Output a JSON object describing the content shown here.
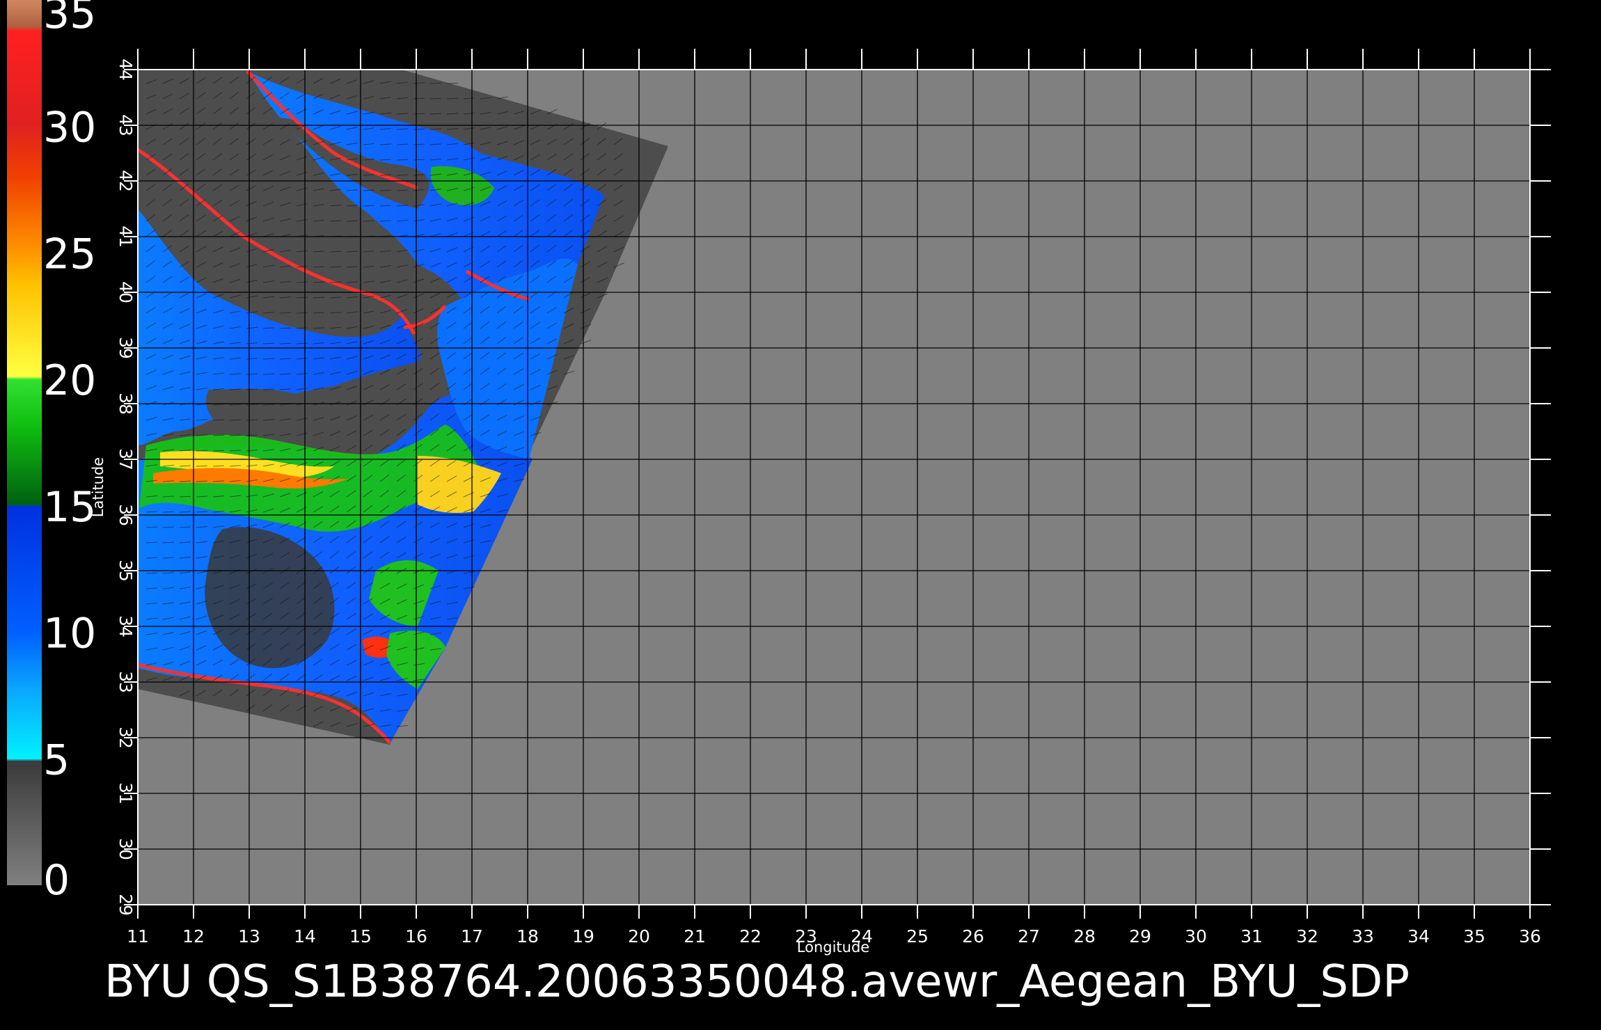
{
  "map": {
    "xlabel": "Longitude",
    "ylabel": "Latitude",
    "lon_range": [
      11,
      36
    ],
    "lat_range": [
      29,
      44
    ],
    "lon_ticks": [
      "11",
      "12",
      "13",
      "14",
      "15",
      "16",
      "17",
      "18",
      "19",
      "20",
      "21",
      "22",
      "23",
      "24",
      "25",
      "26",
      "27",
      "28",
      "29",
      "30",
      "31",
      "32",
      "33",
      "34",
      "35",
      "36"
    ],
    "lat_ticks": [
      "29",
      "30",
      "31",
      "32",
      "33",
      "34",
      "35",
      "36",
      "37",
      "38",
      "39",
      "40",
      "41",
      "42",
      "43",
      "44"
    ],
    "background_color": "#808080",
    "land_color": "#4d4d4d",
    "grid_color": "#000000"
  },
  "colorbar": {
    "min": 0,
    "max": 35,
    "labels": [
      "0",
      "5",
      "10",
      "15",
      "20",
      "25",
      "30",
      "35"
    ],
    "colors": {
      "dark_gray": "#3a3a3a",
      "cyan": "#00f0ff",
      "light_blue": "#0a9bff",
      "blue": "#0038ff",
      "dark_green": "#007a10",
      "green": "#10d010",
      "yellow": "#ffee20",
      "orange": "#ffa000",
      "red_orange": "#f04000",
      "red": "#ff1010",
      "brown": "#c87850"
    }
  },
  "caption": "BYU  QS_S1B38764.20063350048.avewr_Aegean_BYU_SDP"
}
